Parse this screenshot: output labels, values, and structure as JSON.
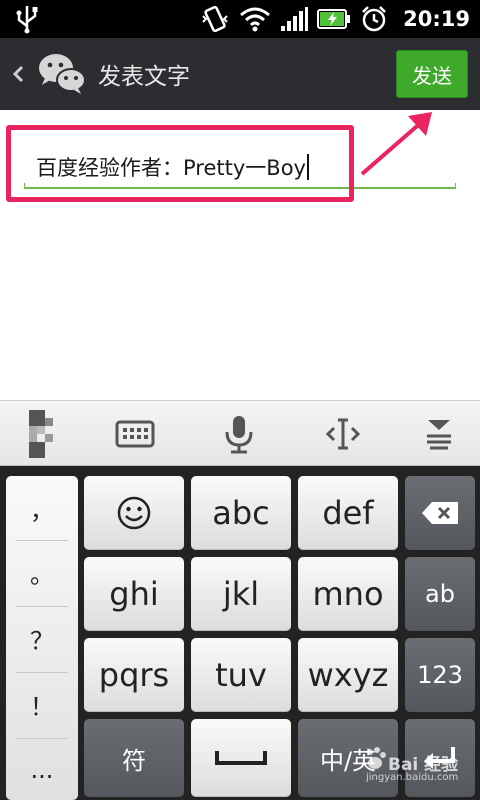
{
  "status_bar": {
    "time": "20:19",
    "icons": [
      "usb-icon",
      "vibrate-icon",
      "wifi-icon",
      "signal-icon",
      "battery-charging-icon",
      "alarm-icon"
    ]
  },
  "title_bar": {
    "title": "发表文字",
    "send_label": "发送"
  },
  "compose": {
    "text": "百度经验作者：Pretty一Boy",
    "highlight_color": "#e9245e",
    "underline_color": "#6fbb52"
  },
  "keyboard_toolbar": {
    "items": [
      "handwriting-icon",
      "keyboard-icon",
      "microphone-icon",
      "cursor-move-icon",
      "hide-keyboard-icon"
    ]
  },
  "keyboard": {
    "punctuation": [
      "，",
      "。",
      "？",
      "！",
      "..."
    ],
    "row1": [
      "☺",
      "abc",
      "def"
    ],
    "row2": [
      "ghi",
      "jkl",
      "mno"
    ],
    "row3": [
      "pqrs",
      "tuv",
      "wxyz"
    ],
    "symbol_label": "符",
    "space_label": "␣",
    "lang_label": "中/英",
    "side_keys": [
      "ab",
      "123"
    ]
  },
  "watermark": {
    "brand": "Bai 经验",
    "url": "jingyan.baidu.com"
  },
  "colors": {
    "send_button": "#3ea92a",
    "title_bar": "#2b2d30"
  }
}
